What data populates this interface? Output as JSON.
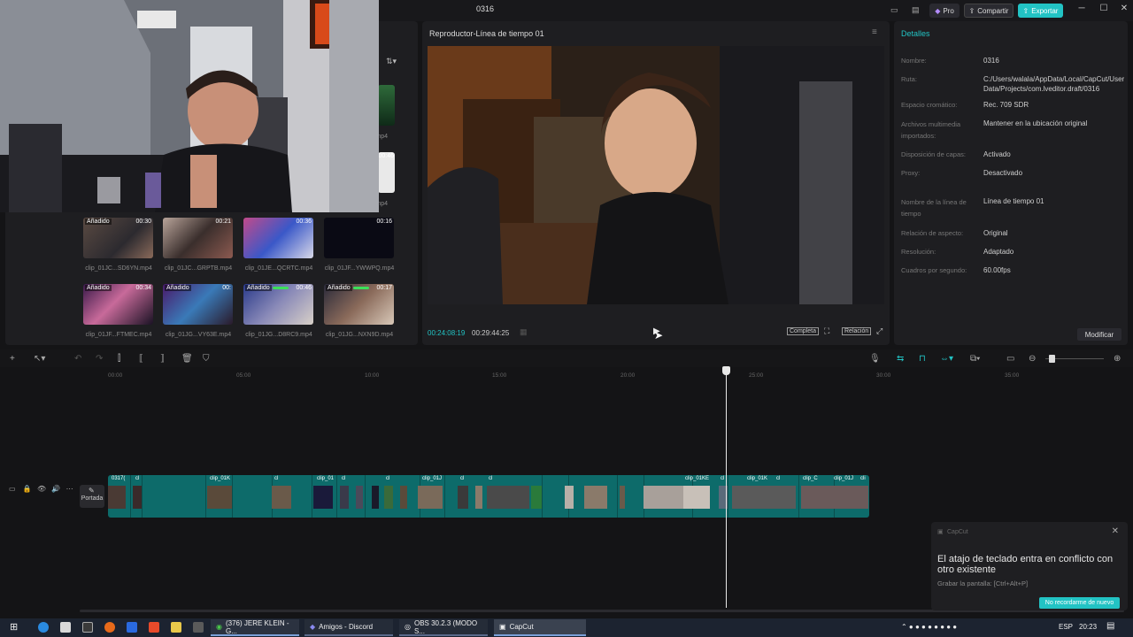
{
  "window": {
    "title": "0316",
    "pro_label": "Pro",
    "share_label": "Compartir",
    "export_label": "Exportar"
  },
  "media": {
    "sort_icon": "filter-sort-icon",
    "thumbs": [
      {
        "badge": "Añadido",
        "duration": "00:30",
        "name": "clip_01JC...SD6YN.mp4"
      },
      {
        "badge": "",
        "duration": "00:21",
        "name": "clip_01JC...GRPTB.mp4"
      },
      {
        "badge": "",
        "duration": "00:36",
        "name": "clip_01JE...QCRTC.mp4"
      },
      {
        "badge": "",
        "duration": "00:16",
        "name": "clip_01JF...YWWPQ.mp4"
      },
      {
        "badge": "Añadido",
        "duration": "00:34",
        "name": "clip_01JF...FTMEC.mp4"
      },
      {
        "badge": "Añadido",
        "duration": "00:",
        "name": "clip_01JG...VY63E.mp4"
      },
      {
        "badge": "Añadido",
        "duration": "00:46",
        "name": "clip_01JG...D8RC9.mp4"
      },
      {
        "badge": "Añadido",
        "duration": "00:17",
        "name": "clip_01JG...NXN9D.mp4"
      }
    ],
    "partial_names": [
      "mp4",
      "mp4"
    ],
    "partial_duration": "00:46"
  },
  "player": {
    "title": "Reproductor-Línea de tiempo 01",
    "current_time": "00:24:08:19",
    "total_time": "00:29:44:25",
    "full_label": "Completa",
    "ratio_label": "Relación"
  },
  "details": {
    "title": "Detalles",
    "rows": [
      {
        "label": "Nombre:",
        "value": "0316"
      },
      {
        "label": "Ruta:",
        "value": "C:/Users/walala/AppData/Local/CapCut/User Data/Projects/com.lveditor.draft/0316"
      },
      {
        "label": "Espacio cromático:",
        "value": "Rec. 709 SDR"
      },
      {
        "label": "Archivos multimedia importados:",
        "value": "Mantener en la ubicación original"
      },
      {
        "label": "Disposición de capas:",
        "value": "Activado"
      },
      {
        "label": "Proxy:",
        "value": "Desactivado"
      },
      {
        "label": "Nombre de la línea de tiempo",
        "value": "Línea de tiempo 01"
      },
      {
        "label": "Relación de aspecto:",
        "value": "Original"
      },
      {
        "label": "Resolución:",
        "value": "Adaptado"
      },
      {
        "label": "Cuadros por segundo:",
        "value": "60.00fps"
      }
    ],
    "modify_label": "Modificar"
  },
  "timeline": {
    "ticks": [
      "00:00",
      "05:00",
      "10:00",
      "15:00",
      "20:00",
      "25:00",
      "30:00",
      "35:00"
    ],
    "cover_label": "Portada",
    "clip_labels": [
      "0317(",
      "cl",
      "clip_01K",
      "cl",
      "clip_01",
      "cl",
      "cl",
      "clip_01J",
      "cl",
      "cl",
      "clip_01KE",
      "cl",
      "clip_01K",
      "cl",
      "clip_C",
      "clip_01J",
      "cli"
    ],
    "playhead_fraction": 0.81
  },
  "notification": {
    "app": "CapCut",
    "message": "El atajo de teclado entra en conflicto con otro existente",
    "sub": "Grabar la pantalla: [Ctrl+Alt+P]",
    "button": "No recordarme de nuevo"
  },
  "taskbar": {
    "tasks": [
      "(376) JERE KLEIN - G...",
      "Amigos - Discord",
      "OBS 30.2.3 (MODO S...",
      "CapCut"
    ],
    "lang": "ESP",
    "time": "20:23"
  }
}
